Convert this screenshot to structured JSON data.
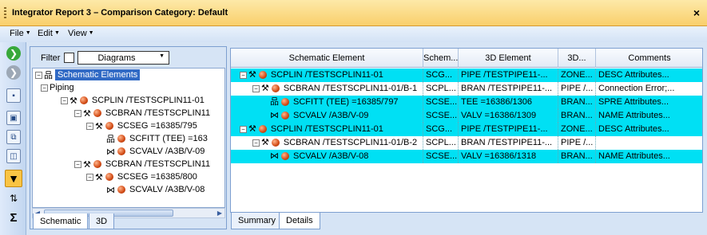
{
  "window": {
    "title": "Integrator Report 3 – Comparison Category: Default",
    "close": "×"
  },
  "menu": [
    {
      "label": "File"
    },
    {
      "label": "Edit"
    },
    {
      "label": "View"
    }
  ],
  "filter": {
    "label": "Filter",
    "checked": false,
    "combo_value": "Diagrams"
  },
  "tree": [
    {
      "label": "Schematic Elements",
      "expander": "⊟",
      "selected": true
    },
    {
      "label": "Piping",
      "expander": "⊟"
    },
    {
      "label": "SCPLIN /TESTSCPLIN11-01",
      "expander": "⊟"
    },
    {
      "label": "SCBRAN /TESTSCPLIN11",
      "expander": "⊟"
    },
    {
      "label": "SCSEG =16385/795",
      "expander": "⊟"
    },
    {
      "label": "SCFITT (TEE) =163"
    },
    {
      "label": "SCVALV /A3B/V-09"
    },
    {
      "label": "SCBRAN /TESTSCPLIN11",
      "expander": "⊟"
    },
    {
      "label": "SCSEG =16385/800",
      "expander": "⊟"
    },
    {
      "label": "SCVALV /A3B/V-08"
    }
  ],
  "left_tabs": [
    {
      "label": "Schematic"
    },
    {
      "label": "3D"
    }
  ],
  "right_tabs": [
    {
      "label": "Summary"
    },
    {
      "label": "Details"
    }
  ],
  "table": {
    "headers": [
      "Schematic Element",
      "Schem...",
      "3D Element",
      "3D...",
      "Comments"
    ],
    "rows": [
      {
        "cells": [
          "SCPLIN /TESTSCPLIN11-01",
          "SCG...",
          "PIPE /TESTPIPE11-...",
          "ZONE...",
          "DESC Attributes..."
        ],
        "highlight": true
      },
      {
        "cells": [
          "SCBRAN /TESTSCPLIN11-01/B-1",
          "SCPL...",
          "BRAN /TESTPIPE11-...",
          "PIPE /...",
          "Connection Error;..."
        ],
        "highlight": false
      },
      {
        "cells": [
          "SCFITT (TEE) =16385/797",
          "SCSE...",
          "TEE =16386/1306",
          "BRAN...",
          "SPRE Attributes..."
        ],
        "highlight": true
      },
      {
        "cells": [
          "SCVALV /A3B/V-09",
          "SCSE...",
          "VALV =16386/1309",
          "BRAN...",
          "NAME Attributes..."
        ],
        "highlight": true
      },
      {
        "cells": [
          "SCPLIN /TESTSCPLIN11-01",
          "SCG...",
          "PIPE /TESTPIPE11-...",
          "ZONE...",
          "DESC Attributes..."
        ],
        "highlight": true
      },
      {
        "cells": [
          "SCBRAN /TESTSCPLIN11-01/B-2",
          "SCPL...",
          "BRAN /TESTPIPE11-...",
          "PIPE /...",
          ""
        ],
        "highlight": false
      },
      {
        "cells": [
          "SCVALV /A3B/V-08",
          "SCSE...",
          "VALV =16386/1318",
          "BRAN...",
          "NAME Attributes..."
        ],
        "highlight": true
      }
    ]
  },
  "colors": {
    "highlight_row": "#00e0f4",
    "titlebar": "#f9cf6b",
    "selection": "#316ac5"
  }
}
